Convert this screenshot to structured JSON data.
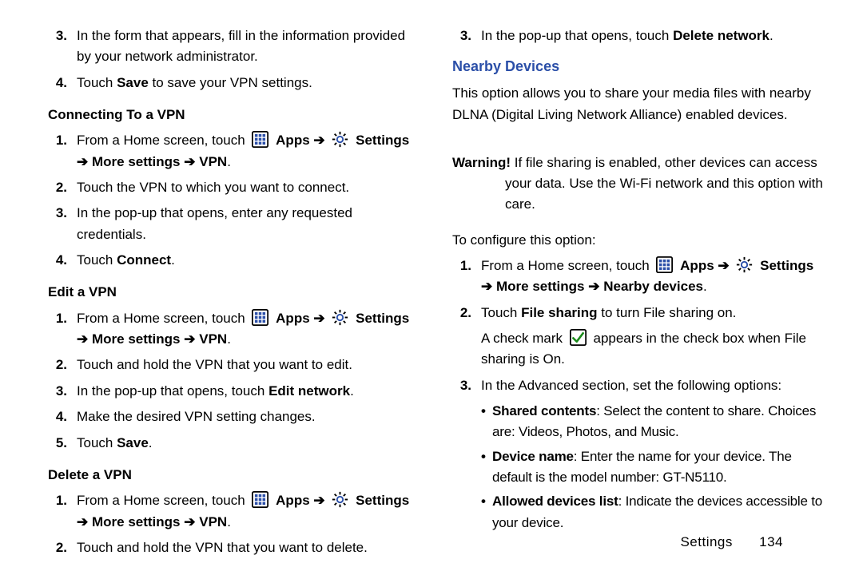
{
  "left": {
    "topList": [
      {
        "n": "3.",
        "parts": [
          {
            "t": "In the form that appears, fill in the information provided by your network administrator."
          }
        ]
      },
      {
        "n": "4.",
        "parts": [
          {
            "t": "Touch "
          },
          {
            "t": "Save",
            "b": true
          },
          {
            "t": " to save your VPN settings."
          }
        ]
      }
    ],
    "h1": "Connecting To a VPN",
    "list1": [
      {
        "n": "1.",
        "parts": [
          {
            "t": "From a Home screen, touch "
          },
          {
            "icon": "apps"
          },
          {
            "t": " "
          },
          {
            "t": "Apps",
            "b": true
          },
          {
            "t": " "
          },
          {
            "arrow": true
          },
          {
            "t": " "
          },
          {
            "icon": "gear"
          },
          {
            "t": " "
          },
          {
            "t": "Settings",
            "b": true
          }
        ],
        "parts2": [
          {
            "arrow": true
          },
          {
            "t": " "
          },
          {
            "t": "More settings",
            "b": true
          },
          {
            "t": " "
          },
          {
            "arrow": true
          },
          {
            "t": " "
          },
          {
            "t": "VPN",
            "b": true
          },
          {
            "t": "."
          }
        ]
      },
      {
        "n": "2.",
        "parts": [
          {
            "t": "Touch the VPN to which you want to connect."
          }
        ]
      },
      {
        "n": "3.",
        "parts": [
          {
            "t": "In the pop-up that opens, enter any requested credentials."
          }
        ]
      },
      {
        "n": "4.",
        "parts": [
          {
            "t": "Touch "
          },
          {
            "t": "Connect",
            "b": true
          },
          {
            "t": "."
          }
        ]
      }
    ],
    "h2": "Edit a VPN",
    "list2": [
      {
        "n": "1.",
        "parts": [
          {
            "t": "From a Home screen, touch "
          },
          {
            "icon": "apps"
          },
          {
            "t": " "
          },
          {
            "t": "Apps",
            "b": true
          },
          {
            "t": " "
          },
          {
            "arrow": true
          },
          {
            "t": " "
          },
          {
            "icon": "gear"
          },
          {
            "t": " "
          },
          {
            "t": "Settings",
            "b": true
          }
        ],
        "parts2": [
          {
            "arrow": true
          },
          {
            "t": " "
          },
          {
            "t": "More settings",
            "b": true
          },
          {
            "t": " "
          },
          {
            "arrow": true
          },
          {
            "t": " "
          },
          {
            "t": "VPN",
            "b": true
          },
          {
            "t": "."
          }
        ]
      },
      {
        "n": "2.",
        "parts": [
          {
            "t": "Touch and hold the VPN that you want to edit."
          }
        ]
      },
      {
        "n": "3.",
        "parts": [
          {
            "t": "In the pop-up that opens, touch "
          },
          {
            "t": "Edit network",
            "b": true
          },
          {
            "t": "."
          }
        ]
      },
      {
        "n": "4.",
        "parts": [
          {
            "t": "Make the desired VPN setting changes."
          }
        ]
      },
      {
        "n": "5.",
        "parts": [
          {
            "t": "Touch "
          },
          {
            "t": "Save",
            "b": true
          },
          {
            "t": "."
          }
        ]
      }
    ],
    "h3": "Delete a VPN",
    "list3": [
      {
        "n": "1.",
        "parts": [
          {
            "t": "From a Home screen, touch "
          },
          {
            "icon": "apps"
          },
          {
            "t": " "
          },
          {
            "t": "Apps",
            "b": true
          },
          {
            "t": " "
          },
          {
            "arrow": true
          },
          {
            "t": " "
          },
          {
            "icon": "gear"
          },
          {
            "t": " "
          },
          {
            "t": "Settings",
            "b": true
          }
        ],
        "parts2": [
          {
            "arrow": true
          },
          {
            "t": " "
          },
          {
            "t": "More settings",
            "b": true
          },
          {
            "t": " "
          },
          {
            "arrow": true
          },
          {
            "t": " "
          },
          {
            "t": "VPN",
            "b": true
          },
          {
            "t": "."
          }
        ]
      },
      {
        "n": "2.",
        "parts": [
          {
            "t": "Touch and hold the VPN that you want to delete."
          }
        ]
      }
    ]
  },
  "right": {
    "topList": [
      {
        "n": "3.",
        "parts": [
          {
            "t": "In the pop-up that opens, touch "
          },
          {
            "t": "Delete network",
            "b": true
          },
          {
            "t": "."
          }
        ]
      }
    ],
    "sectH": "Nearby Devices",
    "intro": "This option allows you to share your media files with nearby DLNA (Digital Living Network Alliance) enabled devices.",
    "warningLabel": "Warning!",
    "warningText": "If file sharing is enabled, other devices can access your data. Use the Wi-Fi network and this option with care.",
    "configLead": "To configure this option:",
    "list1": [
      {
        "n": "1.",
        "parts": [
          {
            "t": "From a Home screen, touch "
          },
          {
            "icon": "apps"
          },
          {
            "t": " "
          },
          {
            "t": "Apps",
            "b": true
          },
          {
            "t": " "
          },
          {
            "arrow": true
          },
          {
            "t": " "
          },
          {
            "icon": "gear"
          },
          {
            "t": " "
          },
          {
            "t": "Settings",
            "b": true
          }
        ],
        "parts2": [
          {
            "arrow": true
          },
          {
            "t": " "
          },
          {
            "t": "More settings",
            "b": true
          },
          {
            "t": " "
          },
          {
            "arrow": true
          },
          {
            "t": " "
          },
          {
            "t": "Nearby devices",
            "b": true
          },
          {
            "t": "."
          }
        ]
      },
      {
        "n": "2.",
        "parts": [
          {
            "t": "Touch "
          },
          {
            "t": "File sharing",
            "b": true
          },
          {
            "t": " to turn File sharing on."
          }
        ],
        "after": [
          {
            "t": "A check mark "
          },
          {
            "icon": "check"
          },
          {
            "t": " appears in the check box when File sharing is On."
          }
        ]
      },
      {
        "n": "3.",
        "parts": [
          {
            "t": "In the Advanced section, set the following options:"
          }
        ]
      }
    ],
    "bullets": [
      {
        "lead": "Shared contents",
        "rest": ": Select the content to share. Choices are: Videos, Photos, and Music."
      },
      {
        "lead": "Device name",
        "rest": ": Enter the name for your device. The default is the model number: GT-N5110."
      },
      {
        "lead": "Allowed devices list",
        "rest": ": Indicate the devices accessible to your device."
      }
    ]
  },
  "footer": {
    "section": "Settings",
    "page": "134"
  },
  "glyph": {
    "arrow": "➔"
  }
}
